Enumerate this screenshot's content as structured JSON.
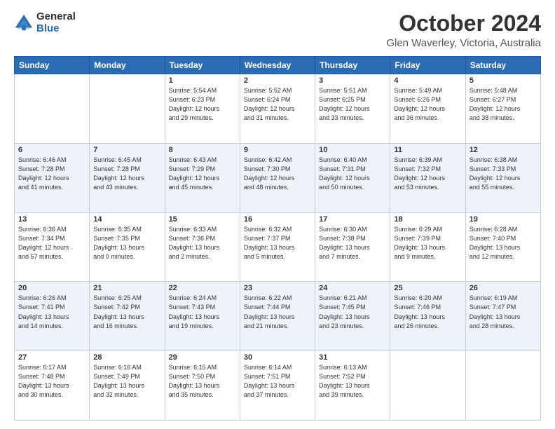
{
  "logo": {
    "general": "General",
    "blue": "Blue"
  },
  "title": "October 2024",
  "location": "Glen Waverley, Victoria, Australia",
  "days_of_week": [
    "Sunday",
    "Monday",
    "Tuesday",
    "Wednesday",
    "Thursday",
    "Friday",
    "Saturday"
  ],
  "weeks": [
    [
      {
        "day": "",
        "info": ""
      },
      {
        "day": "",
        "info": ""
      },
      {
        "day": "1",
        "info": "Sunrise: 5:54 AM\nSunset: 6:23 PM\nDaylight: 12 hours\nand 29 minutes."
      },
      {
        "day": "2",
        "info": "Sunrise: 5:52 AM\nSunset: 6:24 PM\nDaylight: 12 hours\nand 31 minutes."
      },
      {
        "day": "3",
        "info": "Sunrise: 5:51 AM\nSunset: 6:25 PM\nDaylight: 12 hours\nand 33 minutes."
      },
      {
        "day": "4",
        "info": "Sunrise: 5:49 AM\nSunset: 6:26 PM\nDaylight: 12 hours\nand 36 minutes."
      },
      {
        "day": "5",
        "info": "Sunrise: 5:48 AM\nSunset: 6:27 PM\nDaylight: 12 hours\nand 38 minutes."
      }
    ],
    [
      {
        "day": "6",
        "info": "Sunrise: 6:46 AM\nSunset: 7:28 PM\nDaylight: 12 hours\nand 41 minutes."
      },
      {
        "day": "7",
        "info": "Sunrise: 6:45 AM\nSunset: 7:28 PM\nDaylight: 12 hours\nand 43 minutes."
      },
      {
        "day": "8",
        "info": "Sunrise: 6:43 AM\nSunset: 7:29 PM\nDaylight: 12 hours\nand 45 minutes."
      },
      {
        "day": "9",
        "info": "Sunrise: 6:42 AM\nSunset: 7:30 PM\nDaylight: 12 hours\nand 48 minutes."
      },
      {
        "day": "10",
        "info": "Sunrise: 6:40 AM\nSunset: 7:31 PM\nDaylight: 12 hours\nand 50 minutes."
      },
      {
        "day": "11",
        "info": "Sunrise: 6:39 AM\nSunset: 7:32 PM\nDaylight: 12 hours\nand 53 minutes."
      },
      {
        "day": "12",
        "info": "Sunrise: 6:38 AM\nSunset: 7:33 PM\nDaylight: 12 hours\nand 55 minutes."
      }
    ],
    [
      {
        "day": "13",
        "info": "Sunrise: 6:36 AM\nSunset: 7:34 PM\nDaylight: 12 hours\nand 57 minutes."
      },
      {
        "day": "14",
        "info": "Sunrise: 6:35 AM\nSunset: 7:35 PM\nDaylight: 13 hours\nand 0 minutes."
      },
      {
        "day": "15",
        "info": "Sunrise: 6:33 AM\nSunset: 7:36 PM\nDaylight: 13 hours\nand 2 minutes."
      },
      {
        "day": "16",
        "info": "Sunrise: 6:32 AM\nSunset: 7:37 PM\nDaylight: 13 hours\nand 5 minutes."
      },
      {
        "day": "17",
        "info": "Sunrise: 6:30 AM\nSunset: 7:38 PM\nDaylight: 13 hours\nand 7 minutes."
      },
      {
        "day": "18",
        "info": "Sunrise: 6:29 AM\nSunset: 7:39 PM\nDaylight: 13 hours\nand 9 minutes."
      },
      {
        "day": "19",
        "info": "Sunrise: 6:28 AM\nSunset: 7:40 PM\nDaylight: 13 hours\nand 12 minutes."
      }
    ],
    [
      {
        "day": "20",
        "info": "Sunrise: 6:26 AM\nSunset: 7:41 PM\nDaylight: 13 hours\nand 14 minutes."
      },
      {
        "day": "21",
        "info": "Sunrise: 6:25 AM\nSunset: 7:42 PM\nDaylight: 13 hours\nand 16 minutes."
      },
      {
        "day": "22",
        "info": "Sunrise: 6:24 AM\nSunset: 7:43 PM\nDaylight: 13 hours\nand 19 minutes."
      },
      {
        "day": "23",
        "info": "Sunrise: 6:22 AM\nSunset: 7:44 PM\nDaylight: 13 hours\nand 21 minutes."
      },
      {
        "day": "24",
        "info": "Sunrise: 6:21 AM\nSunset: 7:45 PM\nDaylight: 13 hours\nand 23 minutes."
      },
      {
        "day": "25",
        "info": "Sunrise: 6:20 AM\nSunset: 7:46 PM\nDaylight: 13 hours\nand 26 minutes."
      },
      {
        "day": "26",
        "info": "Sunrise: 6:19 AM\nSunset: 7:47 PM\nDaylight: 13 hours\nand 28 minutes."
      }
    ],
    [
      {
        "day": "27",
        "info": "Sunrise: 6:17 AM\nSunset: 7:48 PM\nDaylight: 13 hours\nand 30 minutes."
      },
      {
        "day": "28",
        "info": "Sunrise: 6:16 AM\nSunset: 7:49 PM\nDaylight: 13 hours\nand 32 minutes."
      },
      {
        "day": "29",
        "info": "Sunrise: 6:15 AM\nSunset: 7:50 PM\nDaylight: 13 hours\nand 35 minutes."
      },
      {
        "day": "30",
        "info": "Sunrise: 6:14 AM\nSunset: 7:51 PM\nDaylight: 13 hours\nand 37 minutes."
      },
      {
        "day": "31",
        "info": "Sunrise: 6:13 AM\nSunset: 7:52 PM\nDaylight: 13 hours\nand 39 minutes."
      },
      {
        "day": "",
        "info": ""
      },
      {
        "day": "",
        "info": ""
      }
    ]
  ]
}
